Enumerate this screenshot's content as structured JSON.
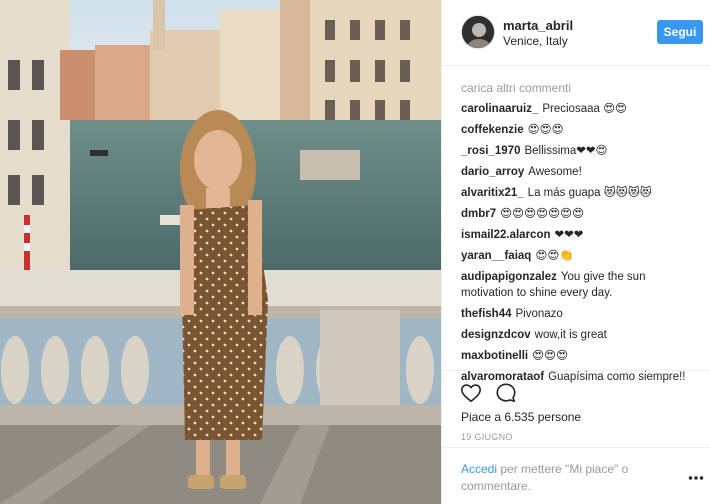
{
  "header": {
    "username": "marta_abril",
    "location": "Venice, Italy",
    "follow_label": "Segui"
  },
  "comments": {
    "load_more": "carica altri commenti",
    "items": [
      {
        "user": "carolinaaruiz_",
        "text": "Preciosaaa 😍😍"
      },
      {
        "user": "coffekenzie",
        "text": "😍😍😍"
      },
      {
        "user": "_rosi_1970",
        "text": "Bellissima❤❤😍"
      },
      {
        "user": "dario_arroy",
        "text": "Awesome!"
      },
      {
        "user": "alvaritix21_",
        "text": "La más guapa 😻😻😻😻"
      },
      {
        "user": "dmbr7",
        "text": "😍😍😍😍😍😍😍"
      },
      {
        "user": "ismail22.alarcon",
        "text": "❤❤❤"
      },
      {
        "user": "yaran__faiaq",
        "text": "😍😍👏"
      },
      {
        "user": "audipapigonzalez",
        "text": "You give the sun motivation to shine every day."
      },
      {
        "user": "thefish44",
        "text": "Pivonazo"
      },
      {
        "user": "designzdcov",
        "text": "wow,it is great"
      },
      {
        "user": "maxbotinelli",
        "text": "😍😍😍"
      },
      {
        "user": "alvaromorataof",
        "text": "Guapísima como siempre!!"
      }
    ]
  },
  "actions": {
    "likes": "Piace a 6.535 persone",
    "date": "19 GIUGNO"
  },
  "footer": {
    "login_link": "Accedi",
    "login_rest": " per mettere \"Mi piace\" o commentare."
  },
  "colors": {
    "accent": "#3897f0",
    "muted": "#999999",
    "text": "#262626"
  }
}
